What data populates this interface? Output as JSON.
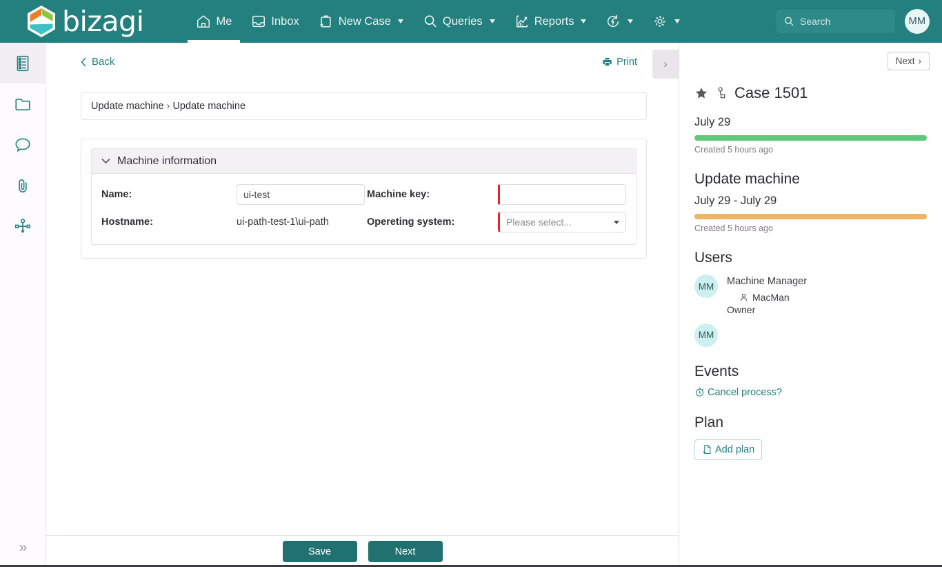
{
  "brand": {
    "name": "bizagi",
    "teal": "#24807e"
  },
  "topnav": {
    "items": [
      {
        "label": "Me",
        "icon": "home-icon",
        "active": true,
        "caret": false
      },
      {
        "label": "Inbox",
        "icon": "inbox-icon",
        "active": false,
        "caret": false
      },
      {
        "label": "New Case",
        "icon": "new-case-icon",
        "active": false,
        "caret": true
      },
      {
        "label": "Queries",
        "icon": "search-icon",
        "active": false,
        "caret": true
      },
      {
        "label": "Reports",
        "icon": "reports-icon",
        "active": false,
        "caret": true
      },
      {
        "label": "",
        "icon": "sync-icon",
        "active": false,
        "caret": true
      },
      {
        "label": "",
        "icon": "gear-icon",
        "active": false,
        "caret": true
      }
    ],
    "search_placeholder": "Search",
    "search_value": "",
    "avatar_initials": "MM"
  },
  "rail": {
    "items": [
      {
        "name": "form-icon",
        "active": true
      },
      {
        "name": "folder-icon",
        "active": false
      },
      {
        "name": "comment-icon",
        "active": false
      },
      {
        "name": "attachment-icon",
        "active": false
      },
      {
        "name": "process-icon",
        "active": false
      }
    ],
    "expand_glyph": "»"
  },
  "toolbar": {
    "back_label": "Back",
    "print_label": "Print",
    "collapse_glyph": "›"
  },
  "breadcrumb": {
    "parts": [
      "Update machine",
      "Update machine"
    ],
    "separator": "›"
  },
  "form": {
    "section_title": "Machine information",
    "fields": {
      "name_label": "Name:",
      "name_value": "ui-test",
      "machine_key_label": "Machine key:",
      "machine_key_value": "",
      "hostname_label": "Hostname:",
      "hostname_value": "ui-path-test-1\\ui-path",
      "os_label": "Opereting system:",
      "os_value": "Please select..."
    }
  },
  "actions": {
    "save_label": "Save",
    "next_label": "Next"
  },
  "right": {
    "next_label": "Next",
    "next_chevron": "›",
    "case_title": "Case 1501",
    "case_date": "July 29",
    "case_progress_note": "Created 5 hours ago",
    "case_progress_color": "#60c87c",
    "activity_title": "Update machine",
    "activity_date": "July 29 - July 29",
    "activity_progress_note": "Created 5 hours ago",
    "activity_progress_color": "#eeb662",
    "users_heading": "Users",
    "users": [
      {
        "initials": "MM",
        "name": "Machine Manager",
        "handle": "MacMan",
        "role": "Owner"
      },
      {
        "initials": "MM",
        "name": "",
        "handle": "",
        "role": ""
      }
    ],
    "events_heading": "Events",
    "event_link": "Cancel process?",
    "plan_heading": "Plan",
    "add_plan_label": "Add plan"
  }
}
